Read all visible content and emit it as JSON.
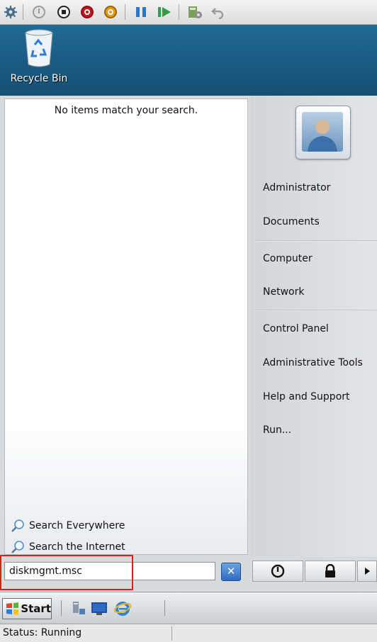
{
  "toolbar": {
    "icons": [
      "settings-icon",
      "power-off-icon",
      "stop-icon",
      "shutdown-icon",
      "power-icon",
      "pause-icon",
      "play-icon",
      "snapshot-icon",
      "revert-icon"
    ]
  },
  "desktop": {
    "recycle_bin_label": "Recycle Bin"
  },
  "start_menu": {
    "search_results_message": "No items match your search.",
    "search_links": [
      "Search Everywhere",
      "Search the Internet"
    ],
    "right_items": {
      "administrator": "Administrator",
      "documents": "Documents",
      "computer": "Computer",
      "network": "Network",
      "control_panel": "Control Panel",
      "administrative_tools": "Administrative Tools",
      "help_and_support": "Help and Support",
      "run": "Run..."
    },
    "search_value": "diskmgmt.msc"
  },
  "taskbar": {
    "start_label": "Start"
  },
  "statusbar": {
    "status": "Status: Running"
  },
  "colors": {
    "desktop_blue": "#1d5c82",
    "highlight_red": "#d0251e",
    "clear_button_blue": "#2f6cc0"
  }
}
